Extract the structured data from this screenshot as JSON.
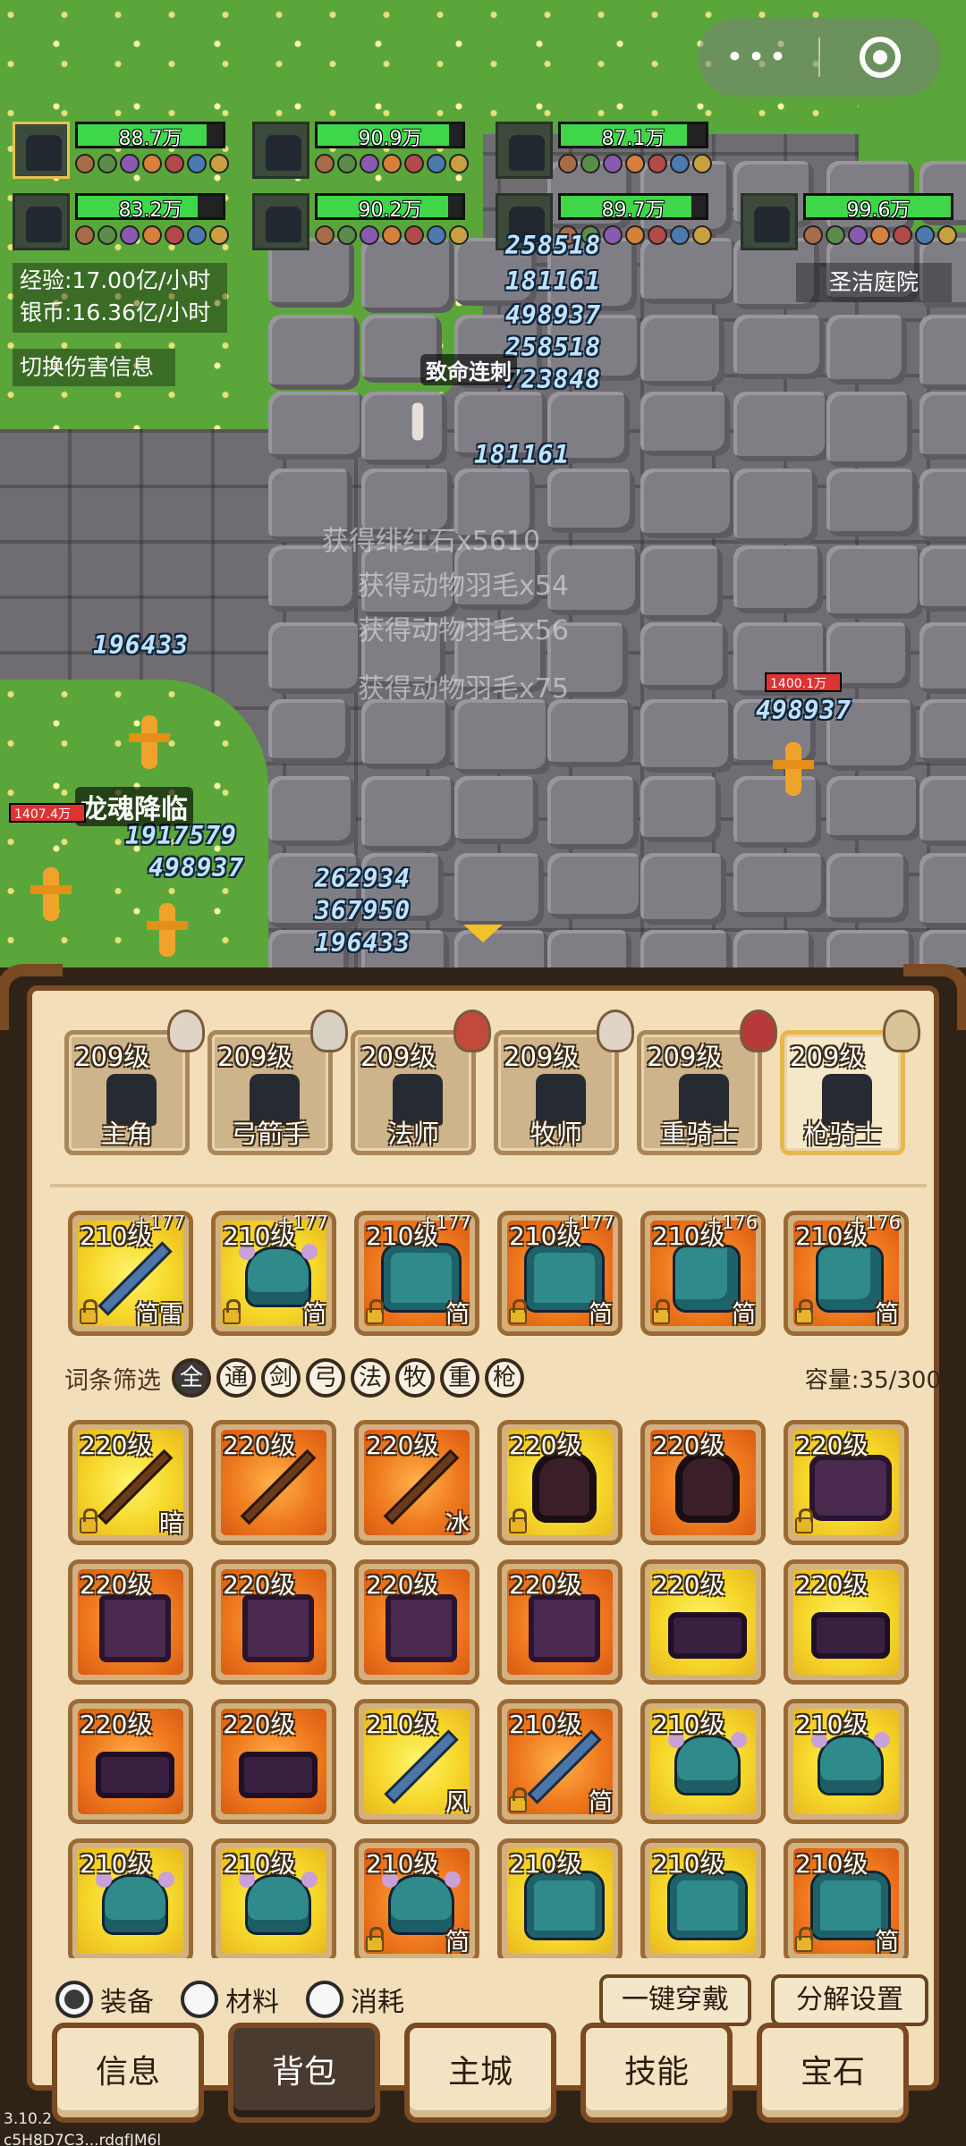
{
  "colors": {
    "accent": "#e9b64a",
    "hp": "#3fd64a",
    "panel": "#f2dfba",
    "frame": "#7a4a22"
  },
  "capsule": {
    "more": "•••",
    "record_icon": "record-icon"
  },
  "heroes": [
    {
      "hp": "88.7万",
      "fill": 0.89,
      "selected": true
    },
    {
      "hp": "90.9万",
      "fill": 0.91,
      "selected": false
    },
    {
      "hp": "87.1万",
      "fill": 0.87,
      "selected": false
    },
    {
      "hp": "83.2万",
      "fill": 0.83,
      "selected": false
    },
    {
      "hp": "90.2万",
      "fill": 0.9,
      "selected": false
    },
    {
      "hp": "89.7万",
      "fill": 0.9,
      "selected": false
    },
    {
      "hp": "99.6万",
      "fill": 1.0,
      "selected": false
    }
  ],
  "stats": {
    "exp": "经验:17.00亿/小时",
    "silver": "银币:16.36亿/小时"
  },
  "toggle_damage": "切换伤害信息",
  "map_name": "圣洁庭院",
  "damage_numbers": [
    "258518",
    "181161",
    "498937",
    "258518",
    "723848",
    "181161",
    "196433",
    "498937",
    "1917579",
    "498937",
    "262934",
    "367950",
    "196433"
  ],
  "skills": {
    "s1": "致命连刺",
    "s2": "龙魂降临"
  },
  "enemy_hp": {
    "e1": "1400.1万",
    "e2": "1407.4万"
  },
  "loot_log": [
    "获得动物羽毛x75",
    "获得动物羽毛x56",
    "获得动物羽毛x54",
    "获得绯红石x5610"
  ],
  "characters": [
    {
      "level": "209级",
      "name": "主角"
    },
    {
      "level": "209级",
      "name": "弓箭手"
    },
    {
      "level": "209级",
      "name": "法师"
    },
    {
      "level": "209级",
      "name": "牧师"
    },
    {
      "level": "209级",
      "name": "重骑士"
    },
    {
      "level": "209级",
      "name": "枪骑士",
      "selected": true
    }
  ],
  "equipped": [
    {
      "level": "210级",
      "plus": "+177",
      "tag": "简雷",
      "icon": "sword",
      "bg": "y"
    },
    {
      "level": "210级",
      "plus": "+177",
      "tag": "简",
      "icon": "helm",
      "bg": "y"
    },
    {
      "level": "210级",
      "plus": "+177",
      "tag": "简",
      "icon": "armor",
      "bg": "o"
    },
    {
      "level": "210级",
      "plus": "+177",
      "tag": "简",
      "icon": "armor",
      "bg": "o"
    },
    {
      "level": "210级",
      "plus": "+176",
      "tag": "简",
      "icon": "glove",
      "bg": "o"
    },
    {
      "level": "210级",
      "plus": "+176",
      "tag": "简",
      "icon": "glove",
      "bg": "o"
    }
  ],
  "filter": {
    "label": "词条筛选",
    "chips": [
      "全",
      "通",
      "剑",
      "弓",
      "法",
      "牧",
      "重",
      "枪"
    ],
    "capacity": "容量:35/300"
  },
  "inventory": [
    {
      "level": "220级",
      "tag": "暗",
      "icon": "staff",
      "bg": "y",
      "lock": true
    },
    {
      "level": "220级",
      "tag": "",
      "icon": "staff",
      "bg": "o",
      "lock": false
    },
    {
      "level": "220级",
      "tag": "冰",
      "icon": "staff",
      "bg": "o",
      "lock": false
    },
    {
      "level": "220级",
      "tag": "",
      "icon": "dmask",
      "bg": "y",
      "lock": true
    },
    {
      "level": "220级",
      "tag": "",
      "icon": "dmask",
      "bg": "o",
      "lock": false
    },
    {
      "level": "220级",
      "tag": "",
      "icon": "drobe",
      "bg": "y",
      "lock": true
    },
    {
      "level": "220级",
      "tag": "",
      "icon": "dpants",
      "bg": "o",
      "lock": false
    },
    {
      "level": "220级",
      "tag": "",
      "icon": "dpants",
      "bg": "o",
      "lock": false
    },
    {
      "level": "220级",
      "tag": "",
      "icon": "dpants",
      "bg": "o",
      "lock": false
    },
    {
      "level": "220级",
      "tag": "",
      "icon": "dpants",
      "bg": "o",
      "lock": false
    },
    {
      "level": "220级",
      "tag": "",
      "icon": "dboots",
      "bg": "y",
      "lock": false
    },
    {
      "level": "220级",
      "tag": "",
      "icon": "dboots",
      "bg": "y",
      "lock": false
    },
    {
      "level": "220级",
      "tag": "",
      "icon": "dboots",
      "bg": "o",
      "lock": false
    },
    {
      "level": "220级",
      "tag": "",
      "icon": "dboots",
      "bg": "o",
      "lock": false
    },
    {
      "level": "210级",
      "tag": "风",
      "icon": "sword",
      "bg": "y",
      "lock": false
    },
    {
      "level": "210级",
      "tag": "简",
      "icon": "sword",
      "bg": "o",
      "lock": true
    },
    {
      "level": "210级",
      "tag": "",
      "icon": "helm",
      "bg": "y",
      "lock": false
    },
    {
      "level": "210级",
      "tag": "",
      "icon": "helm",
      "bg": "y",
      "lock": false
    },
    {
      "level": "210级",
      "tag": "",
      "icon": "helm",
      "bg": "y",
      "lock": false
    },
    {
      "level": "210级",
      "tag": "",
      "icon": "helm",
      "bg": "y",
      "lock": false
    },
    {
      "level": "210级",
      "tag": "简",
      "icon": "helm",
      "bg": "o",
      "lock": true
    },
    {
      "level": "210级",
      "tag": "",
      "icon": "armor",
      "bg": "y",
      "lock": false
    },
    {
      "level": "210级",
      "tag": "",
      "icon": "armor",
      "bg": "y",
      "lock": false
    },
    {
      "level": "210级",
      "tag": "简",
      "icon": "armor",
      "bg": "o",
      "lock": true
    }
  ],
  "tabs": {
    "equip": "装备",
    "material": "材料",
    "consume": "消耗",
    "equip_all": "一键穿戴",
    "decompose": "分解设置"
  },
  "nav": [
    "信息",
    "背包",
    "主城",
    "技能",
    "宝石"
  ],
  "version": "3.10.2",
  "device_id": "c5H8D7C3...rdqfJM6l"
}
